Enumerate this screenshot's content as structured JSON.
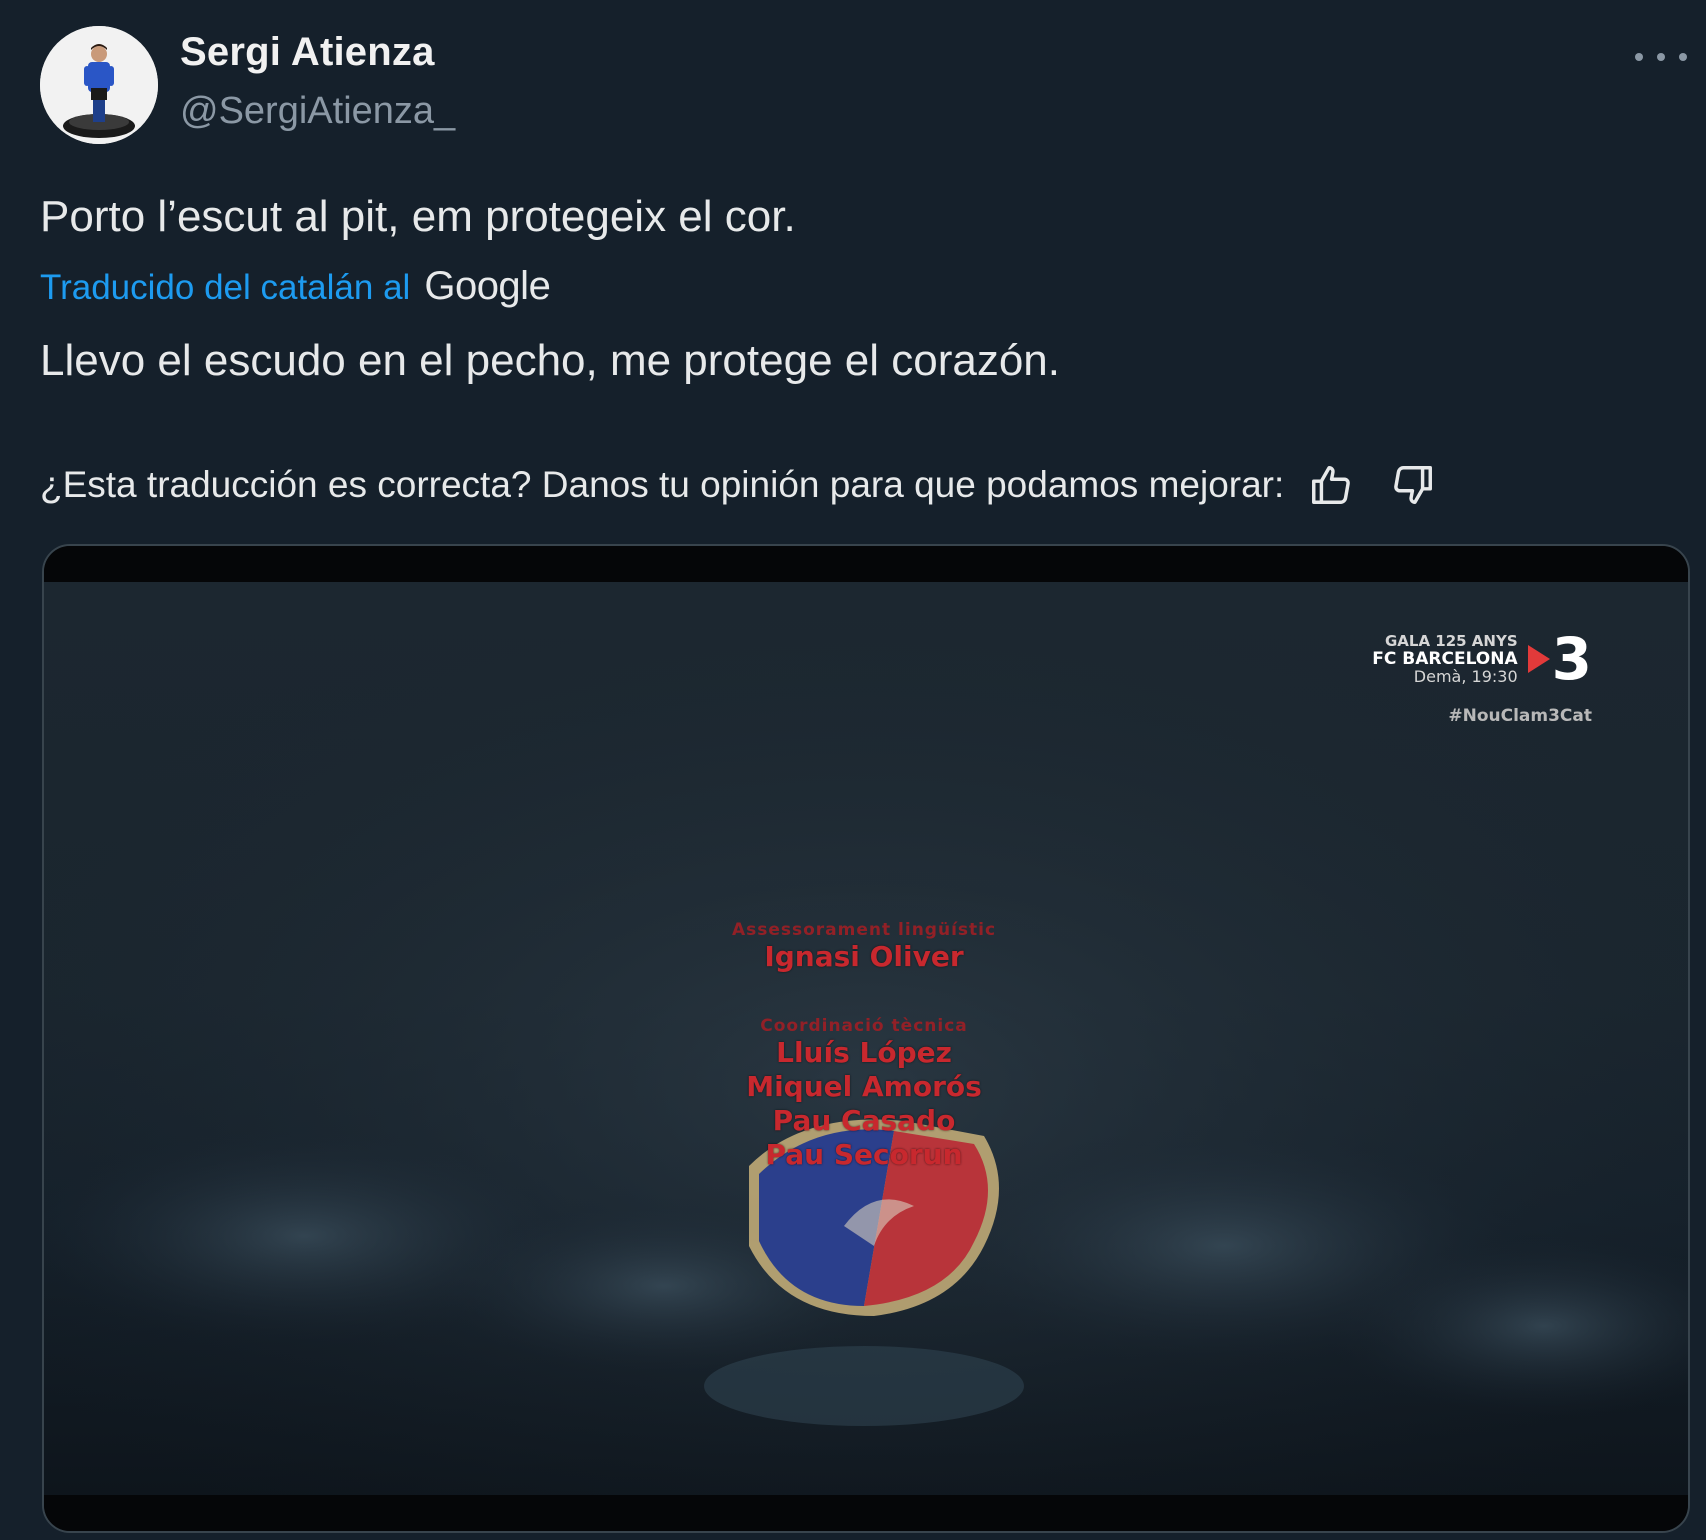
{
  "author": {
    "display_name": "Sergi Atienza",
    "handle": "@SergiAtienza_",
    "avatar_icon": "subbuteo-player-avatar"
  },
  "tweet": {
    "original_text": "Porto l’escut al pit, em protegeix el cor.",
    "translated_by_label": "Traducido del catalán al",
    "translation_provider": "Google",
    "translated_text": "Llevo el escudo en el pecho, me protege el corazón.",
    "feedback_question": "¿Esta traducción es correcta? Danos tu opinión para que podamos mejorar:"
  },
  "media": {
    "gala_line1": "GALA 125 ANYS",
    "gala_line2": "FC BARCELONA",
    "gala_line3": "Demà, 19:30",
    "channel_number": "3",
    "hashtag": "#NouClam3Cat",
    "credits": [
      {
        "role": "Assessorament lingüístic",
        "names": [
          "Ignasi Oliver"
        ]
      },
      {
        "role": "Coordinació tècnica",
        "names": [
          "Lluís López",
          "Miquel Amorós",
          "Pau Casado",
          "Pau Secorun"
        ]
      }
    ]
  },
  "colors": {
    "background": "#15202b",
    "link": "#1d9bf0",
    "secondary_text": "#8b98a5",
    "credit_red": "#c8282e"
  }
}
